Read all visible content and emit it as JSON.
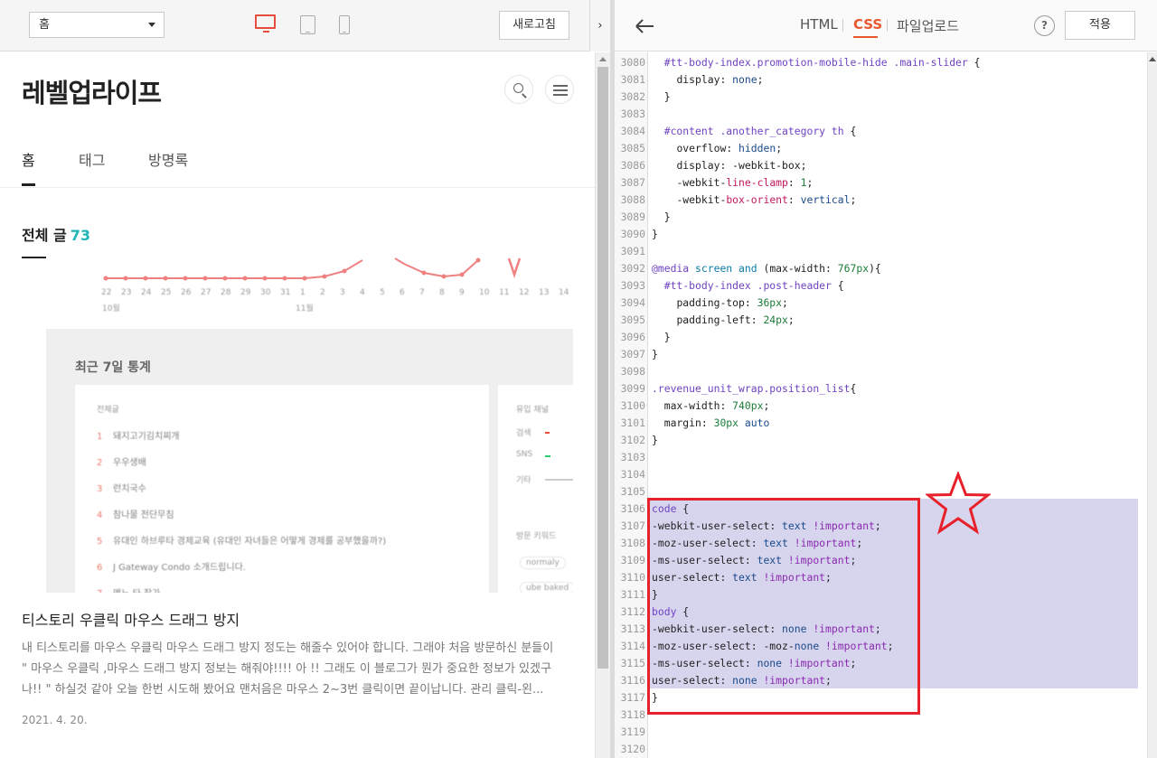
{
  "left_toolbar": {
    "page_select": "홈",
    "refresh_label": "새로고침",
    "collapse_glyph": "›"
  },
  "preview": {
    "blog_title": "레벨업라이프",
    "nav": {
      "home": "홈",
      "tag": "태그",
      "guestbook": "방명록"
    },
    "all_posts_label": "전체 글",
    "all_posts_count": "73",
    "thumbnail": {
      "x_ticks": [
        "22",
        "23",
        "24",
        "25",
        "26",
        "27",
        "28",
        "29",
        "30",
        "31",
        "1",
        "2",
        "3",
        "4",
        "5",
        "6",
        "7",
        "8",
        "9",
        "10",
        "11",
        "12",
        "13",
        "14",
        "1"
      ],
      "month_left": "10월",
      "month_right": "11월",
      "heading": "최근 7일 통계",
      "list_header": "전체글",
      "list_items": [
        {
          "n": "1",
          "t": "돼지고기김치찌개"
        },
        {
          "n": "2",
          "t": "우우생배"
        },
        {
          "n": "3",
          "t": "런치국수"
        },
        {
          "n": "4",
          "t": "참나물 전단무침"
        },
        {
          "n": "5",
          "t": "유대인 하브루타 경제교육 (유대인 자녀들은 어떻게 경제를 공부했을까?)"
        },
        {
          "n": "6",
          "t": "J Gateway Condo 소개드립니다."
        },
        {
          "n": "7",
          "t": "멘노 타 작가"
        }
      ],
      "side_header": "유입 채널",
      "side_rows": [
        "검색",
        "SNS",
        "기타"
      ],
      "side_header2": "방문 키워드",
      "side_tag1": "normaly",
      "side_tag2": "ube baked"
    },
    "post": {
      "title": "티스토리 우클릭 마우스 드래그 방지",
      "excerpt": "내 티스토리를 마우스 우클릭 마우스 드래그 방지 정도는 해줄수 있어야 합니다. 그래야 처음 방문하신 분들이 \" 마우스 우클릭 ,마우스 드래그 방지 정보는 해줘야!!!! 아 !! 그래도 이 블로그가 뭔가 중요한 정보가 있겠구나!! \" 하실것 같아 오늘 한번 시도해 봤어요 맨처음은 마우스 2~3번 클릭이면 끝이납니다. 관리 클릭-왼...",
      "date": "2021. 4. 20."
    }
  },
  "right_toolbar": {
    "tabs": {
      "html": "HTML",
      "css": "CSS",
      "upload": "파일업로드"
    },
    "help": "?",
    "apply_label": "적용"
  },
  "editor": {
    "lines": [
      {
        "n": "3080",
        "c": "  #tt-body-index.promotion-mobile-hide .main-slider {"
      },
      {
        "n": "3081",
        "c": "    display: none;"
      },
      {
        "n": "3082",
        "c": "  }"
      },
      {
        "n": "3083",
        "c": ""
      },
      {
        "n": "3084",
        "c": "  #content .another_category th {"
      },
      {
        "n": "3085",
        "c": "    overflow: hidden;"
      },
      {
        "n": "3086",
        "c": "    display: -webkit-box;"
      },
      {
        "n": "3087",
        "c": "    -webkit-line-clamp: 1;"
      },
      {
        "n": "3088",
        "c": "    -webkit-box-orient: vertical;"
      },
      {
        "n": "3089",
        "c": "  }"
      },
      {
        "n": "3090",
        "c": "}"
      },
      {
        "n": "3091",
        "c": ""
      },
      {
        "n": "3092",
        "c": "@media screen and (max-width: 767px){"
      },
      {
        "n": "3093",
        "c": "  #tt-body-index .post-header {"
      },
      {
        "n": "3094",
        "c": "    padding-top: 36px;"
      },
      {
        "n": "3095",
        "c": "    padding-left: 24px;"
      },
      {
        "n": "3096",
        "c": "  }"
      },
      {
        "n": "3097",
        "c": "}"
      },
      {
        "n": "3098",
        "c": ""
      },
      {
        "n": "3099",
        "c": ".revenue_unit_wrap.position_list{"
      },
      {
        "n": "3100",
        "c": "  max-width: 740px;"
      },
      {
        "n": "3101",
        "c": "  margin: 30px auto"
      },
      {
        "n": "3102",
        "c": "}"
      },
      {
        "n": "3103",
        "c": ""
      },
      {
        "n": "3104",
        "c": ""
      },
      {
        "n": "3105",
        "c": ""
      },
      {
        "n": "3106",
        "c": "code {"
      },
      {
        "n": "3107",
        "c": "-webkit-user-select: text !important;"
      },
      {
        "n": "3108",
        "c": "-moz-user-select: text !important;"
      },
      {
        "n": "3109",
        "c": "-ms-user-select: text !important;"
      },
      {
        "n": "3110",
        "c": "user-select: text !important;"
      },
      {
        "n": "3111",
        "c": "}"
      },
      {
        "n": "3112",
        "c": "body {"
      },
      {
        "n": "3113",
        "c": "-webkit-user-select: none !important;"
      },
      {
        "n": "3114",
        "c": "-moz-user-select: -moz-none !important;"
      },
      {
        "n": "3115",
        "c": "-ms-user-select: none !important;"
      },
      {
        "n": "3116",
        "c": "user-select: none !important;"
      },
      {
        "n": "3117",
        "c": "}"
      },
      {
        "n": "3118",
        "c": ""
      },
      {
        "n": "3119",
        "c": ""
      },
      {
        "n": "3120",
        "c": ""
      }
    ]
  },
  "colors": {
    "accent_orange": "#e8572e",
    "desktop_red": "#e74c3c",
    "count_teal": "#1eb6b6",
    "highlight_red": "#e8202a",
    "selection": "#d7d4ee"
  }
}
